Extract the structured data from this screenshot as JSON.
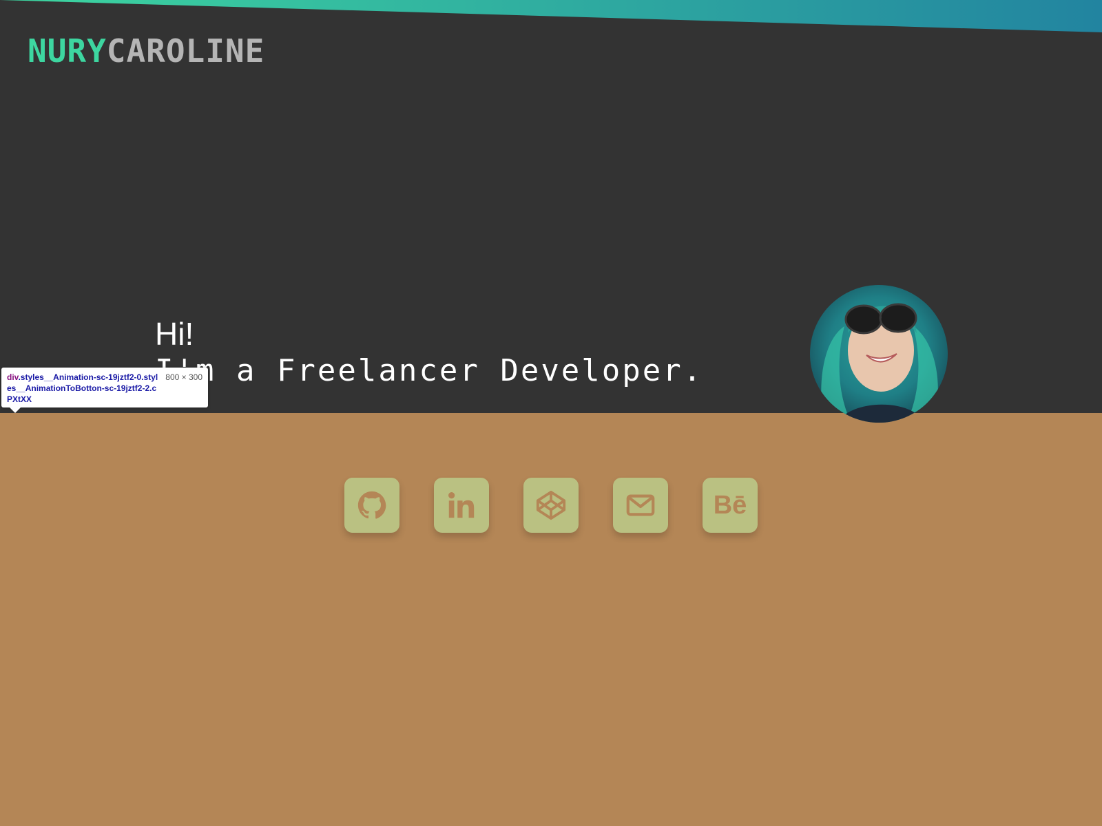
{
  "header": {
    "logo_first": "NURY",
    "logo_second": "CAROLINE"
  },
  "hero": {
    "greeting": "Hi!",
    "tagline": "I'm a Freelancer Developer."
  },
  "avatar": {
    "alt": "Profile photo"
  },
  "socials": [
    {
      "label": "GitHub",
      "icon": "github-icon"
    },
    {
      "label": "LinkedIn",
      "icon": "linkedin-icon"
    },
    {
      "label": "CodePen",
      "icon": "codepen-icon"
    },
    {
      "label": "Email",
      "icon": "mail-icon"
    },
    {
      "label": "Behance",
      "icon": "behance-icon",
      "text": "Bē"
    }
  ],
  "tooltip": {
    "tag": "div",
    "classes": ".styles__Animation-sc-19jztf2-0.styles__AnimationToBotton-sc-19jztf2-2.cPXtXX",
    "size": "800 × 300"
  },
  "colors": {
    "background_dark": "#333333",
    "accent_green": "#3dd6a0",
    "logo_gray": "#b5b5b5",
    "lower_background": "#b48656",
    "social_button": "#bac182",
    "stripe_start": "#3dd6a0",
    "stripe_end": "#2284a0"
  }
}
